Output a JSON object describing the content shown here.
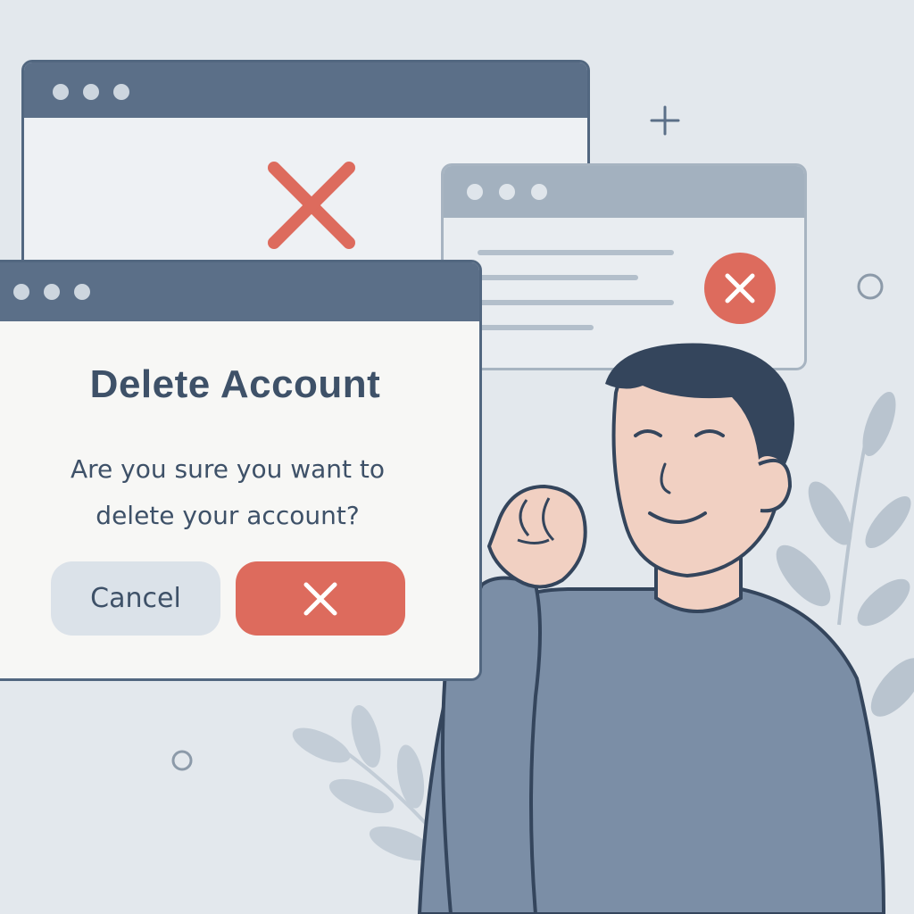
{
  "dialog": {
    "title": "Delete Account",
    "message_line1": "Are you sure you want to",
    "message_line2": "delete your account?",
    "cancel_label": "Cancel",
    "confirm_icon": "close-icon"
  },
  "colors": {
    "background": "#e3e8ed",
    "window_bar": "#5b6f88",
    "accent_red": "#dd6b5d",
    "text": "#3e5168"
  },
  "icons": [
    "close-icon",
    "plus-icon",
    "ring-icon",
    "leaf-icon"
  ]
}
